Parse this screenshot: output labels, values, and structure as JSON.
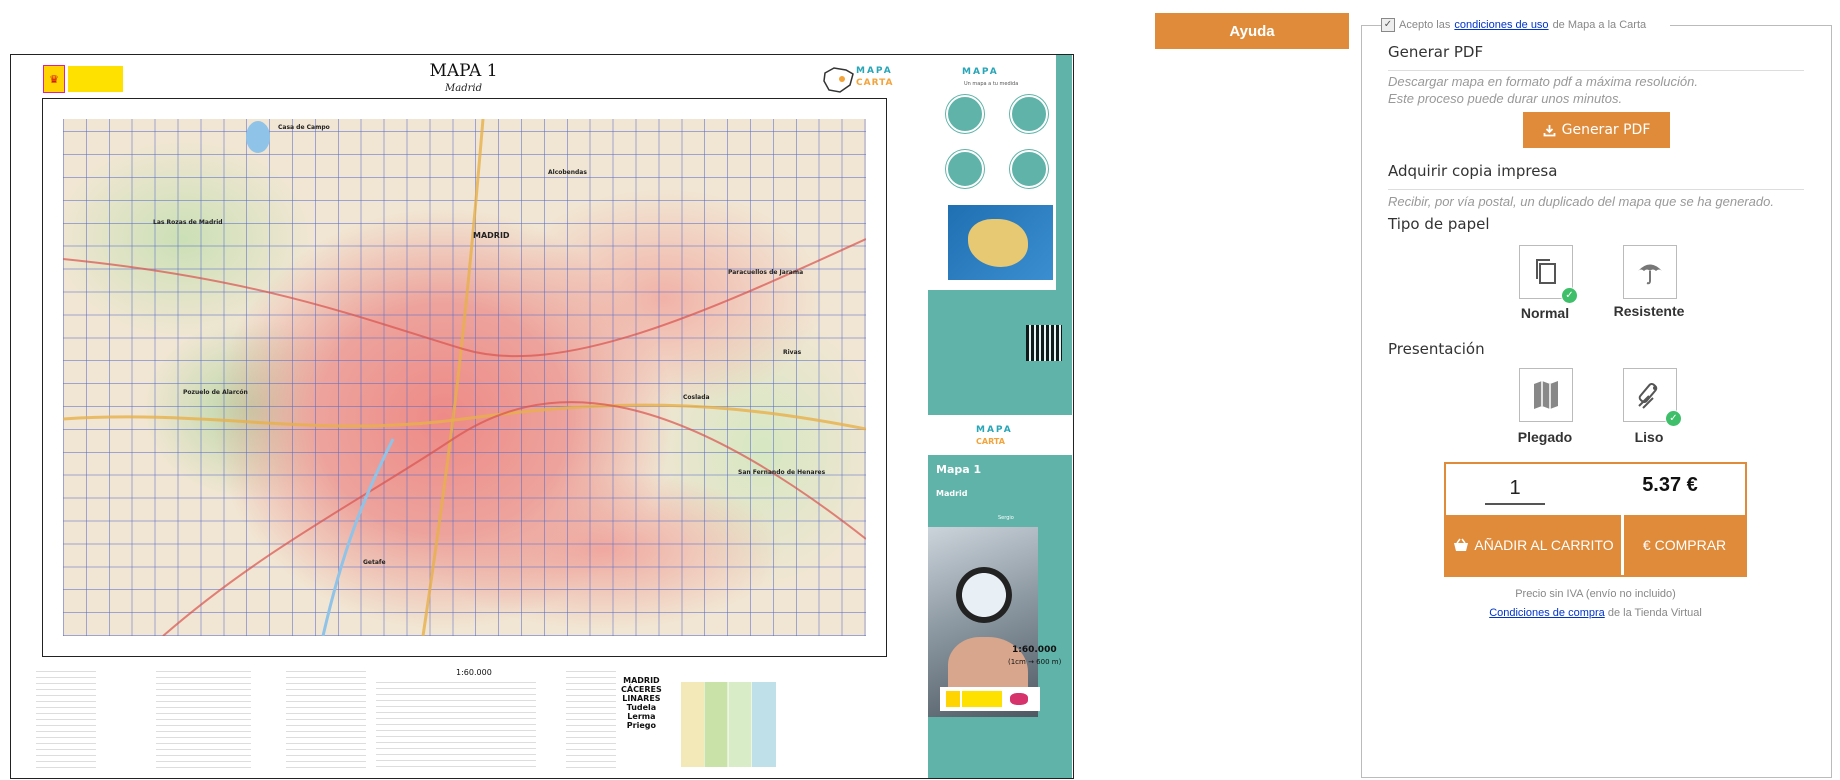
{
  "map_sheet": {
    "title": "MAPA 1",
    "subtitle": "Madrid",
    "brand_word": "MAPA",
    "brand_word2": "CARTA",
    "brand_tag": "Un mapa a tu medida",
    "map_labels": [
      "MADRID",
      "Casa de Campo",
      "Alcobendas",
      "Las Rozas de Madrid",
      "Pozuelo de Alarcón",
      "Getafe",
      "Coslada",
      "San Fernando de Henares",
      "Paracuellos de Jarama",
      "Rivas"
    ],
    "side_title": "Mapa 1",
    "side_subtitle": "Madrid",
    "side_author": "Sergio",
    "scale": "1:60.000",
    "scale_detail": "(1cm → 600 m)",
    "legend_scale": "1:60.000",
    "legend_cities": [
      "MADRID",
      "CÁCERES",
      "LINARES",
      "Tudela",
      "Lerma",
      "Priego"
    ]
  },
  "help_button": "Ayuda",
  "accept": {
    "prefix": "Acepto las",
    "link": "condiciones de uso",
    "suffix": "de Mapa a la Carta"
  },
  "pdf": {
    "heading": "Generar PDF",
    "desc_line1": "Descargar mapa en formato pdf a máxima resolución.",
    "desc_line2": "Este proceso puede durar unos minutos.",
    "button": "Generar PDF"
  },
  "print": {
    "heading": "Adquirir copia impresa",
    "desc": "Recibir, por vía postal, un duplicado del mapa que se ha generado."
  },
  "paper_type": {
    "heading": "Tipo de papel",
    "options": [
      {
        "label": "Normal",
        "icon": "copy-icon",
        "selected": true
      },
      {
        "label": "Resistente",
        "icon": "umbrella-icon",
        "selected": false
      }
    ]
  },
  "presentation": {
    "heading": "Presentación",
    "options": [
      {
        "label": "Plegado",
        "icon": "folded-map-icon",
        "selected": false
      },
      {
        "label": "Liso",
        "icon": "rolled-map-icon",
        "selected": true
      }
    ]
  },
  "order": {
    "quantity": "1",
    "price": "5.37 €",
    "cart_button": "AÑADIR AL CARRITO",
    "buy_button": "COMPRAR",
    "buy_symbol": "€"
  },
  "footer": {
    "price_note": "Precio sin IVA (envío no incluido)",
    "conditions_link": "Condiciones de compra",
    "conditions_suffix": "de la Tienda Virtual"
  },
  "colors": {
    "accent": "#e08b3a",
    "teal": "#5fb3a9",
    "link": "#0033cc",
    "check": "#3fbf6a"
  }
}
